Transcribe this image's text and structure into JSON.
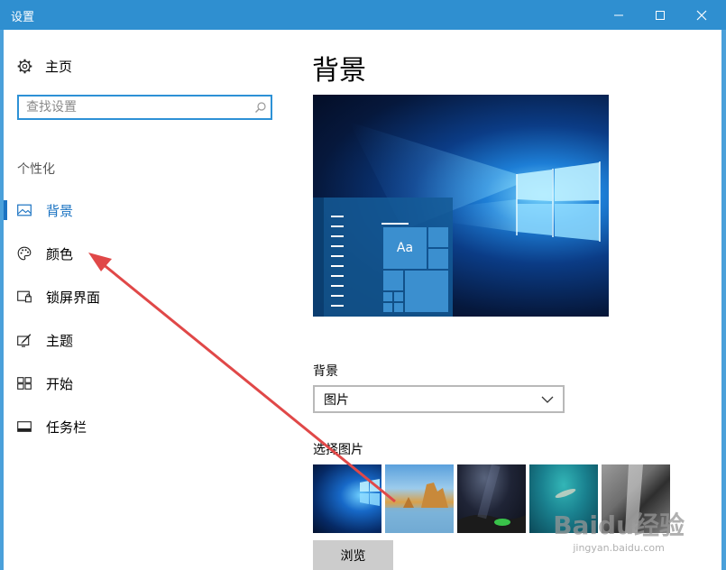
{
  "window": {
    "title": "设置"
  },
  "sidebar": {
    "home_label": "主页",
    "search_placeholder": "查找设置",
    "section_label": "个性化",
    "items": [
      {
        "label": "背景",
        "icon": "picture-icon",
        "active": true
      },
      {
        "label": "颜色",
        "icon": "palette-icon",
        "active": false
      },
      {
        "label": "锁屏界面",
        "icon": "lock-screen-icon",
        "active": false
      },
      {
        "label": "主题",
        "icon": "theme-brush-icon",
        "active": false
      },
      {
        "label": "开始",
        "icon": "start-tiles-icon",
        "active": false
      },
      {
        "label": "任务栏",
        "icon": "taskbar-icon",
        "active": false
      }
    ]
  },
  "main": {
    "title": "背景",
    "preview_tile_text": "Aa",
    "background_label": "背景",
    "background_value": "图片",
    "choose_label": "选择图片",
    "browse_label": "浏览"
  },
  "watermark": {
    "brand": "Baidu经验",
    "url": "jingyan.baidu.com"
  },
  "colors": {
    "titlebar": "#2f8fd0",
    "accent": "#1b73c2",
    "annotation_arrow": "#e04848"
  }
}
